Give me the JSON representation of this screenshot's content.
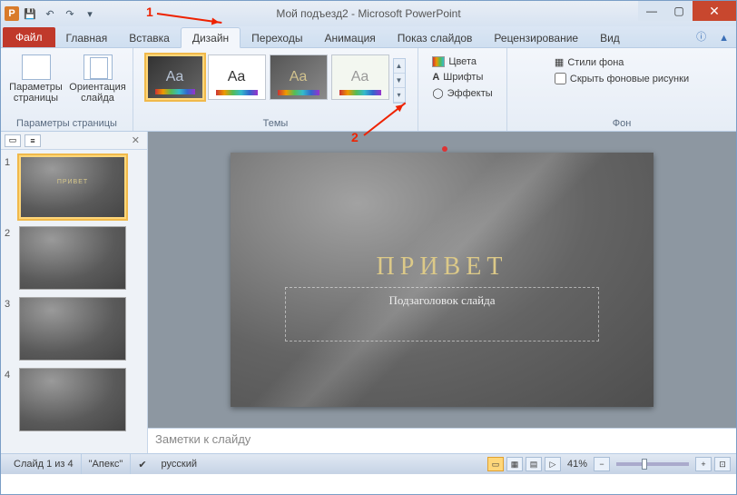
{
  "window": {
    "title_doc": "Мой подъезд2",
    "title_app": "Microsoft PowerPoint"
  },
  "qat": {
    "save": "💾",
    "undo": "↶",
    "redo": "↷",
    "more": "▾"
  },
  "tabs": {
    "file": "Файл",
    "home": "Главная",
    "insert": "Вставка",
    "design": "Дизайн",
    "transitions": "Переходы",
    "animations": "Анимация",
    "slideshow": "Показ слайдов",
    "review": "Рецензирование",
    "view": "Вид"
  },
  "ribbon": {
    "page_setup_group": "Параметры страницы",
    "page_setup_btn": "Параметры страницы",
    "orientation_btn": "Ориентация слайда",
    "themes_group": "Темы",
    "theme_aa": "Aa",
    "colors": "Цвета",
    "fonts": "Шрифты",
    "effects": "Эффекты",
    "bg_group": "Фон",
    "bg_styles": "Стили фона",
    "hide_bg": "Скрыть фоновые рисунки"
  },
  "thumbs": {
    "n1": "1",
    "n2": "2",
    "n3": "3",
    "n4": "4",
    "mini_title": "ПРИВЕТ"
  },
  "slide": {
    "title": "ПРИВЕТ",
    "subtitle": "Подзаголовок слайда"
  },
  "notes": {
    "placeholder": "Заметки к слайду"
  },
  "status": {
    "slide_info": "Слайд 1 из 4",
    "theme": "\"Апекс\"",
    "lang": "русский",
    "zoom": "41%"
  },
  "anno": {
    "one": "1",
    "two": "2"
  }
}
